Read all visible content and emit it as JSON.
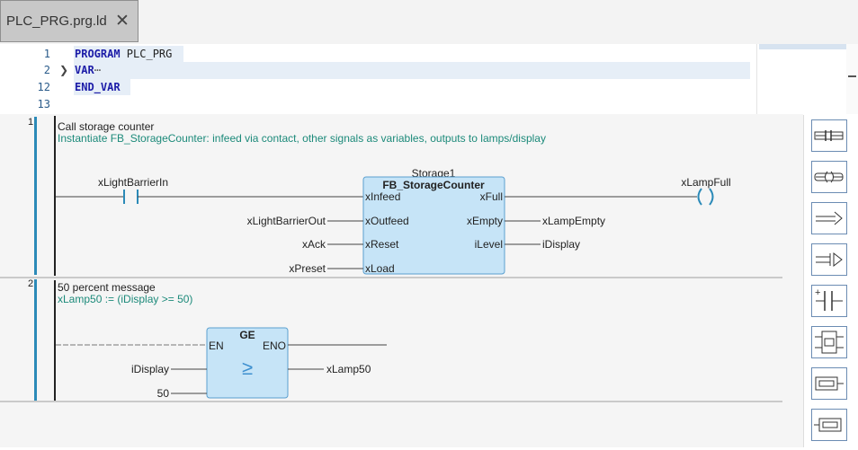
{
  "tab": {
    "title": "PLC_PRG.prg.ld"
  },
  "declaration": {
    "lines": [
      {
        "num": "1",
        "keyword": "PROGRAM",
        "rest": " PLC_PRG"
      },
      {
        "num": "2",
        "keyword": "VAR",
        "rest": "⋯"
      },
      {
        "num": "12",
        "keyword": "END_VAR",
        "rest": ""
      },
      {
        "num": "13",
        "keyword": "",
        "rest": ""
      }
    ]
  },
  "networks": [
    {
      "number": "1",
      "title": "Call storage counter",
      "comment": "Instantiate FB_StorageCounter: infeed via contact, other signals as variables, outputs to lamps/display",
      "contact": "xLightBarrierIn",
      "coil": "xLampFull",
      "block": {
        "instance": "Storage1",
        "type": "FB_StorageCounter",
        "inputs": [
          "xInfeed",
          "xOutfeed",
          "xReset",
          "xLoad"
        ],
        "outputs": [
          "xFull",
          "xEmpty",
          "iLevel"
        ]
      },
      "input_vars": [
        "xLightBarrierOut",
        "xAck",
        "xPreset"
      ],
      "output_vars": [
        "xLampEmpty",
        "iDisplay"
      ]
    },
    {
      "number": "2",
      "title": "50 percent message",
      "comment": "xLamp50 := (iDisplay >= 50)",
      "block": {
        "type": "GE",
        "en": "EN",
        "eno": "ENO",
        "symbol": "≥"
      },
      "input_vars": [
        "iDisplay",
        "50"
      ],
      "output_var": "xLamp50"
    }
  ],
  "toolbox": [
    "contact-tool-icon",
    "negated-contact-tool-icon",
    "coil-tool-icon",
    "set-coil-tool-icon",
    "parallel-contact-tool-icon",
    "insert-box-tool-icon",
    "box-tool-icon",
    "empty-box-tool-icon"
  ],
  "colors": {
    "block_fill": "#c6e4f7",
    "block_border": "#5a9fcf",
    "rail_accent": "#2b8ab8",
    "comment": "#1c8a7a"
  }
}
